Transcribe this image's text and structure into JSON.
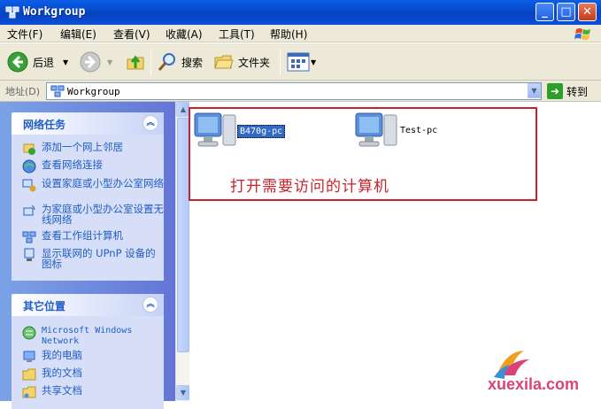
{
  "window": {
    "title": "Workgroup",
    "buttons": {
      "minimize": "_",
      "maximize": "□",
      "close": "✕"
    }
  },
  "menu": [
    {
      "label": "文件(F)"
    },
    {
      "label": "编辑(E)"
    },
    {
      "label": "查看(V)"
    },
    {
      "label": "收藏(A)"
    },
    {
      "label": "工具(T)"
    },
    {
      "label": "帮助(H)"
    }
  ],
  "toolbar": {
    "back_label": "后退",
    "search_label": "搜索",
    "folders_label": "文件夹"
  },
  "address": {
    "label": "地址(D)",
    "value": "Workgroup",
    "go_label": "转到"
  },
  "network_tasks": {
    "title": "网络任务",
    "items": [
      {
        "label": "添加一个网上邻居",
        "icon": "add-network-place-icon"
      },
      {
        "label": "查看网络连接",
        "icon": "network-connections-icon"
      },
      {
        "label": "设置家庭或小型办公室网络",
        "icon": "home-network-icon"
      },
      {
        "label": "为家庭或小型办公室设置无线网络",
        "icon": "wireless-network-icon"
      },
      {
        "label": "查看工作组计算机",
        "icon": "workgroup-computers-icon"
      },
      {
        "label": "显示联网的 UPnP 设备的图标",
        "icon": "upnp-device-icon"
      }
    ]
  },
  "other_places": {
    "title": "其它位置",
    "items": [
      {
        "label": "Microsoft Windows Network",
        "icon": "windows-network-icon"
      },
      {
        "label": "我的电脑",
        "icon": "my-computer-icon"
      },
      {
        "label": "我的文档",
        "icon": "my-documents-icon"
      },
      {
        "label": "共享文档",
        "icon": "shared-documents-icon"
      }
    ]
  },
  "computers": [
    {
      "name": "B470g-pc",
      "selected": true
    },
    {
      "name": "Test-pc",
      "selected": false
    }
  ],
  "annotation": "打开需要访问的计算机",
  "watermark": "xuexila.com",
  "colors": {
    "titlebar": "#0543c2",
    "task_link": "#215dc6",
    "annotation_red": "#c8232c",
    "watermark": "#d9437a"
  }
}
